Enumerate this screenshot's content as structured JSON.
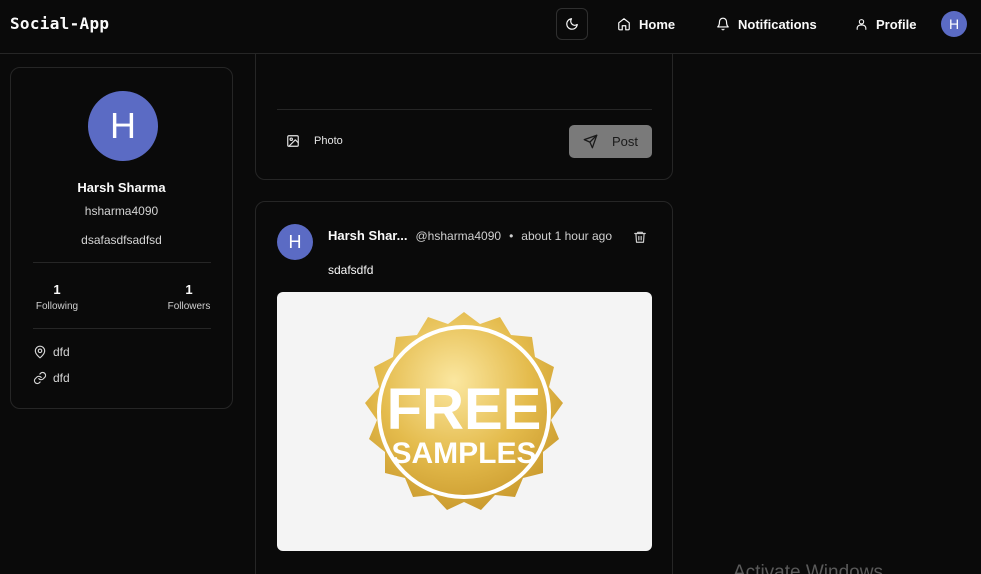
{
  "navbar": {
    "brand": "Social-App",
    "links": [
      {
        "label": "Home",
        "icon": "home-icon"
      },
      {
        "label": "Notifications",
        "icon": "bell-icon"
      },
      {
        "label": "Profile",
        "icon": "user-icon"
      }
    ],
    "avatar_initial": "H",
    "theme_icon": "moon-icon"
  },
  "profile": {
    "avatar_initial": "H",
    "name": "Harsh Sharma",
    "username": "hsharma4090",
    "bio": "dsafasdfsadfsd",
    "following_count": "1",
    "following_label": "Following",
    "followers_count": "1",
    "followers_label": "Followers",
    "location": "dfd",
    "website": "dfd"
  },
  "compose": {
    "photo_label": "Photo",
    "post_label": "Post"
  },
  "post": {
    "avatar_initial": "H",
    "author": "Harsh Shar...",
    "handle": "@hsharma4090",
    "separator": "•",
    "time": "about 1 hour ago",
    "content": "sdafsdfd",
    "image": {
      "line1": "FREE",
      "line2": "SAMPLES"
    }
  },
  "watermark": "Activate Windows",
  "colors": {
    "background": "#0a0a0a",
    "border": "#262626",
    "avatar": "#5b6bc4",
    "post_button": "#7a7a7a",
    "badge_gold": "#e0b84a"
  }
}
